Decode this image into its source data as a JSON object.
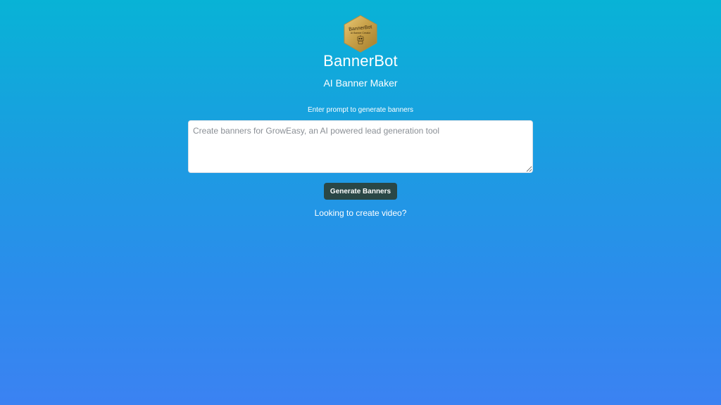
{
  "brand": {
    "logo_text": "BannerBot",
    "logo_subtext": "AI Banner Creator",
    "title": "BannerBot",
    "subtitle": "AI Banner Maker"
  },
  "prompt": {
    "label": "Enter prompt to generate banners",
    "placeholder": "Create banners for GrowEasy, an AI powered lead generation tool",
    "value": ""
  },
  "actions": {
    "generate_label": "Generate Banners",
    "video_link_label": "Looking to create video?"
  },
  "colors": {
    "bg_top": "#08b3d6",
    "bg_bottom": "#3b82f2",
    "button_bg": "#2a4746",
    "logo_gold": "#c9a24a"
  }
}
